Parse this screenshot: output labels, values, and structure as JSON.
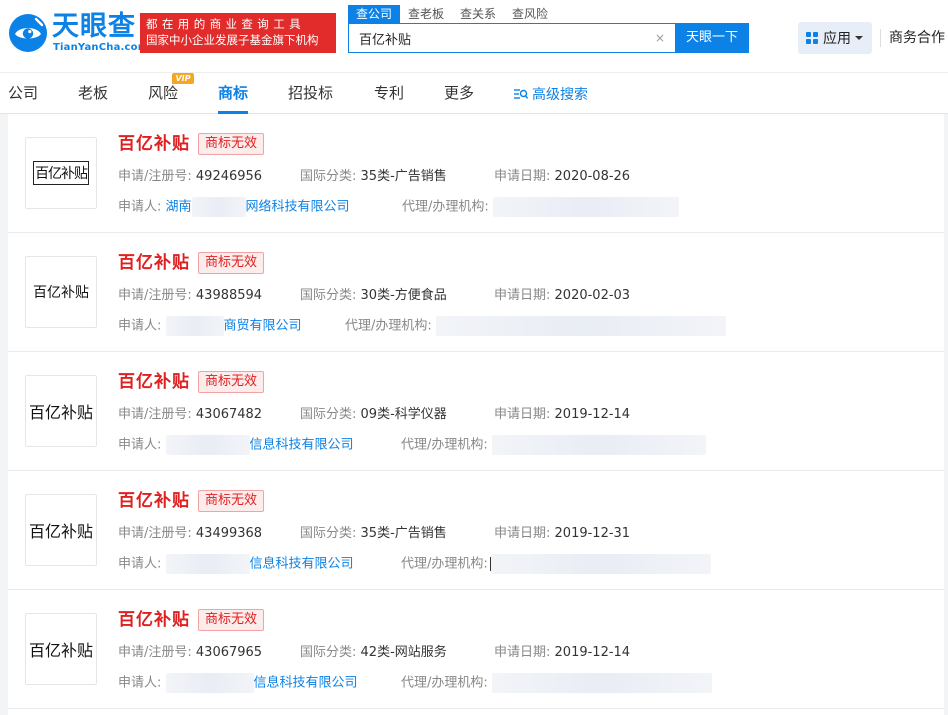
{
  "header": {
    "logo_cn": "天眼查",
    "logo_en": "TianYanCha.com",
    "slogan_line1": "都在用的商业查询工具",
    "slogan_line2": "国家中小企业发展子基金旗下机构",
    "search_tabs": [
      {
        "label": "查公司",
        "active": true
      },
      {
        "label": "查老板",
        "active": false
      },
      {
        "label": "查关系",
        "active": false
      },
      {
        "label": "查风险",
        "active": false
      }
    ],
    "search_value": "百亿补贴",
    "clear_symbol": "×",
    "search_button": "天眼一下",
    "apps_label": "应用",
    "biz_link": "商务合作"
  },
  "nav": {
    "items": [
      {
        "label": "公司",
        "active": false
      },
      {
        "label": "老板",
        "active": false
      },
      {
        "label": "风险",
        "active": false
      },
      {
        "label": "商标",
        "active": true
      },
      {
        "label": "招投标",
        "active": false
      },
      {
        "label": "专利",
        "active": false
      },
      {
        "label": "更多",
        "active": false
      }
    ],
    "vip_badge": "VIP",
    "advanced_search": "高级搜索"
  },
  "labels": {
    "reg_no": "申请/注册号:",
    "intl_class": "国际分类:",
    "apply_date": "申请日期:",
    "applicant": "申请人:",
    "agency": "代理/办理机构:"
  },
  "trademarks": [
    {
      "image_text": "百亿补贴",
      "name": "百亿补贴",
      "status": "商标无效",
      "reg_no": "49246956",
      "intl_class": "35类-广告销售",
      "apply_date": "2020-08-26",
      "applicant_prefix": "湖南",
      "applicant_suffix": "网络科技有限公司"
    },
    {
      "image_text": "百亿补贴",
      "name": "百亿补贴",
      "status": "商标无效",
      "reg_no": "43988594",
      "intl_class": "30类-方便食品",
      "apply_date": "2020-02-03",
      "applicant_prefix": "",
      "applicant_suffix": "商贸有限公司"
    },
    {
      "image_text": "百亿补贴",
      "name": "百亿补贴",
      "status": "商标无效",
      "reg_no": "43067482",
      "intl_class": "09类-科学仪器",
      "apply_date": "2019-12-14",
      "applicant_prefix": "",
      "applicant_suffix": "信息科技有限公司"
    },
    {
      "image_text": "百亿补贴",
      "name": "百亿补贴",
      "status": "商标无效",
      "reg_no": "43499368",
      "intl_class": "35类-广告销售",
      "apply_date": "2019-12-31",
      "applicant_prefix": "",
      "applicant_suffix": "信息科技有限公司"
    },
    {
      "image_text": "百亿补贴",
      "name": "百亿补贴",
      "status": "商标无效",
      "reg_no": "43067965",
      "intl_class": "42类-网站服务",
      "apply_date": "2019-12-14",
      "applicant_prefix": "",
      "applicant_suffix": "信息科技有限公司"
    }
  ],
  "colors": {
    "brand": "#0c82e6",
    "danger": "#e02020",
    "slogan_bg": "#e22b2b"
  }
}
